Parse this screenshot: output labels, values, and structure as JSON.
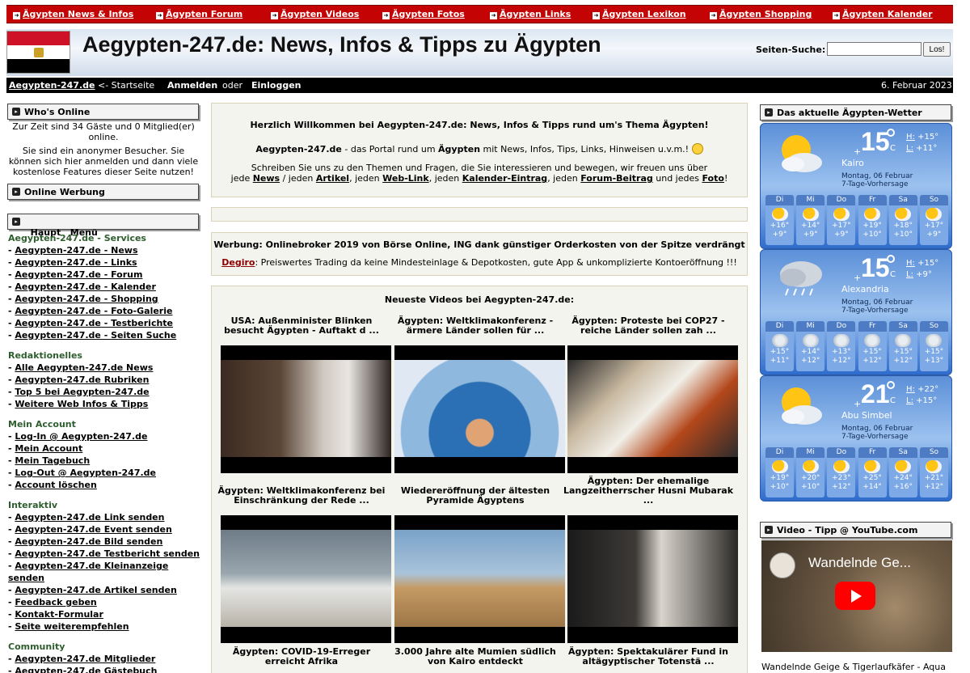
{
  "topnav": [
    "Ägypten News & Infos",
    "Ägypten Forum",
    "Ägypten Videos",
    "Ägypten Fotos",
    "Ägypten Links",
    "Ägypten Lexikon",
    "Ägypten Shopping",
    "Ägypten Kalender"
  ],
  "header": {
    "title": "Aegypten-247.de: News, Infos & Tipps zu Ägypten",
    "search_label": "Seiten-Suche:",
    "search_value": "",
    "search_button": "Los!"
  },
  "bar": {
    "home_link": "Aegypten-247.de",
    "home_suffix": "<- Startseite",
    "login": "Anmelden",
    "or": "oder",
    "register": "Einloggen",
    "date": "6. Februar 2023"
  },
  "whos_online": {
    "title": "Who's Online",
    "line1": "Zur Zeit sind 34 Gäste und 0 Mitglied(er) online.",
    "line2": "Sie sind ein anonymer Besucher. Sie können sich hier anmelden und dann viele kostenlose Features dieser Seite nutzen!"
  },
  "online_werbung": {
    "title": "Online Werbung"
  },
  "menu": {
    "title": "Haupt   Menü",
    "sections": [
      {
        "title": "Aegypten-247.de - Services",
        "items": [
          "Aegypten-247.de - News",
          "Aegypten-247.de - Links",
          "Aegypten-247.de - Forum",
          "Aegypten-247.de - Kalender",
          "Aegypten-247.de - Shopping",
          "Aegypten-247.de - Foto-Galerie",
          "Aegypten-247.de - Testberichte",
          "Aegypten-247.de - Seiten Suche"
        ]
      },
      {
        "title": "Redaktionelles",
        "items": [
          "Alle Aegypten-247.de News",
          "Aegypten-247.de Rubriken",
          "Top 5 bei Aegypten-247.de",
          "Weitere Web Infos & Tipps"
        ]
      },
      {
        "title": "Mein Account",
        "items": [
          "Log-In @ Aegypten-247.de",
          "Mein Account",
          "Mein Tagebuch",
          "Log-Out @ Aegypten-247.de",
          "Account löschen"
        ]
      },
      {
        "title": "Interaktiv",
        "items": [
          "Aegypten-247.de Link senden",
          "Aegypten-247.de Event senden",
          "Aegypten-247.de Bild senden",
          "Aegypten-247.de Testbericht senden",
          "Aegypten-247.de Kleinanzeige senden",
          "Aegypten-247.de Artikel senden",
          "Feedback geben",
          "Kontakt-Formular",
          "Seite weiterempfehlen"
        ]
      },
      {
        "title": "Community",
        "items": [
          "Aegypten-247.de Mitglieder",
          "Aegypten-247.de Gästebuch"
        ]
      }
    ]
  },
  "welcome": {
    "headline": "Herzlich Willkommen bei Aegypten-247.de: News, Infos & Tipps rund um's Thema Ägypten!",
    "p2_site": "Aegypten-247.de",
    "p2_a": " - das Portal rund um ",
    "p2_b": "Ägypten",
    "p2_c": " mit News, Infos, Tips, Links, Hinweisen u.v.m.!",
    "p3_line1": "Schreiben Sie uns zu den Themen und Fragen, die Sie interessieren und bewegen, wir freuen uns über",
    "p3_parts": [
      "jede ",
      "News",
      " / jeden ",
      "Artikel",
      ", jeden ",
      "Web-Link",
      ", jeden ",
      "Kalender-Eintrag",
      ", jeden ",
      "Forum-Beitrag",
      " und jedes ",
      "Foto",
      "!"
    ]
  },
  "ad": {
    "headline": "Werbung: Onlinebroker 2019 von Börse Online, ING dank günstiger Orderkosten von der Spitze verdrängt",
    "link": "Degiro",
    "text": ": Preiswertes Trading da keine Mindesteinlage & Depotkosten, gute App & unkomplizierte Kontoeröffnung !!!"
  },
  "videos": {
    "title": "Neueste Videos bei Aegypten-247.de:",
    "row1_captions": [
      "USA: Außenminister Blinken besucht Ägypten - Auftakt d ...",
      "Ägypten: Weltklimakonferenz - ärmere Länder sollen für ...",
      "Ägypten: Proteste bei COP27 - reiche Länder sollen zah ..."
    ],
    "row2_captions": [
      "Ägypten: Weltklimakonferenz bei Einschränkung der Rede ...",
      "Wiedereröffnung der ältesten Pyramide Ägyptens",
      "Ägypten: Der ehemalige Langzeitherrscher Husni Mubarak ..."
    ],
    "row3_captions": [
      "Ägypten: COVID-19-Erreger erreicht Afrika",
      "3.000 Jahre alte Mumien südlich von Kairo entdeckt",
      "Ägypten: Spektakulärer Fund in altägyptischer Totenstä ..."
    ]
  },
  "weather": {
    "title": "Das aktuelle Ägypten-Wetter",
    "cards": [
      {
        "plus": "+",
        "temp": "15",
        "unit": "C",
        "hi": "+15°",
        "lo": "+11°",
        "city": "Kairo",
        "date": "Montag, 06 Februar",
        "forecast": "7-Tage-Vorhersage",
        "days": [
          [
            "Di",
            "+16°",
            "+9°"
          ],
          [
            "Mi",
            "+14°",
            "+9°"
          ],
          [
            "Do",
            "+17°",
            "+9°"
          ],
          [
            "Fr",
            "+19°",
            "+10°"
          ],
          [
            "Sa",
            "+18°",
            "+10°"
          ],
          [
            "So",
            "+17°",
            "+9°"
          ]
        ]
      },
      {
        "plus": "+",
        "temp": "15",
        "unit": "C",
        "hi": "+15°",
        "lo": "+9°",
        "city": "Alexandria",
        "date": "Montag, 06 Februar",
        "forecast": "7-Tage-Vorhersage",
        "days": [
          [
            "Di",
            "+15°",
            "+11°"
          ],
          [
            "Mi",
            "+14°",
            "+12°"
          ],
          [
            "Do",
            "+13°",
            "+12°"
          ],
          [
            "Fr",
            "+15°",
            "+12°"
          ],
          [
            "Sa",
            "+15°",
            "+12°"
          ],
          [
            "So",
            "+15°",
            "+13°"
          ]
        ]
      },
      {
        "plus": "+",
        "temp": "21",
        "unit": "C",
        "hi": "+22°",
        "lo": "+15°",
        "city": "Abu Simbel",
        "date": "Montag, 06 Februar",
        "forecast": "7-Tage-Vorhersage",
        "days": [
          [
            "Di",
            "+19°",
            "+10°"
          ],
          [
            "Mi",
            "+20°",
            "+10°"
          ],
          [
            "Do",
            "+23°",
            "+12°"
          ],
          [
            "Fr",
            "+25°",
            "+14°"
          ],
          [
            "Sa",
            "+24°",
            "+16°"
          ],
          [
            "So",
            "+21°",
            "+12°"
          ]
        ]
      }
    ]
  },
  "video_tipp": {
    "title": "Video - Tipp @ YouTube.com",
    "video_title": "Wandelnde Ge...",
    "caption": "Wandelnde Geige & Tigerlaufkäfer - Aqua"
  },
  "colors": {
    "nav_red": "#c40404",
    "flag_red": "#ce1126",
    "flag_black": "#000000",
    "menu_section_green": "#2e5e2e",
    "weather_blue": "#5b8fd8"
  }
}
